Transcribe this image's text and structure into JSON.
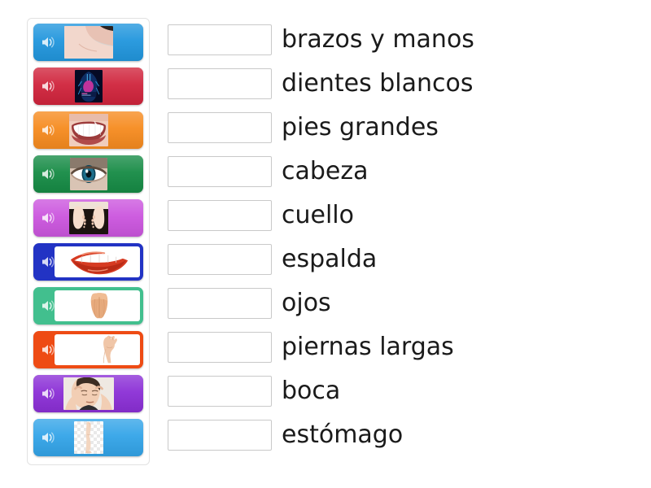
{
  "activity": {
    "type": "match-up-audio-to-text",
    "language": "es"
  },
  "tiles_panel": {
    "name": "audio-tiles-panel",
    "tiles": [
      {
        "index": 1,
        "color": "#2196dd",
        "style": "solid",
        "icon": "speaker-icon",
        "image": "neck-photo",
        "alt": "cuello"
      },
      {
        "index": 2,
        "color": "#d0243c",
        "style": "solid",
        "icon": "speaker-icon",
        "image": "stomach-diagram",
        "alt": "estomago"
      },
      {
        "index": 3,
        "color": "#f68b1f",
        "style": "solid",
        "icon": "speaker-icon",
        "image": "white-teeth-photo",
        "alt": "dientes blancos"
      },
      {
        "index": 4,
        "color": "#168b45",
        "style": "solid",
        "icon": "speaker-icon",
        "image": "eye-photo",
        "alt": "ojos"
      },
      {
        "index": 5,
        "color": "#cb55de",
        "style": "solid",
        "icon": "speaker-icon",
        "image": "baby-feet-photo",
        "alt": "pies grandes"
      },
      {
        "index": 6,
        "color": "#2233c4",
        "style": "framed",
        "icon": "speaker-icon",
        "image": "mouth-lips-clipart",
        "alt": "boca"
      },
      {
        "index": 7,
        "color": "#42bf8e",
        "style": "framed",
        "icon": "speaker-icon",
        "image": "back-torso-clipart",
        "alt": "espalda"
      },
      {
        "index": 8,
        "color": "#ee4b14",
        "style": "framed",
        "icon": "speaker-icon",
        "image": "raised-arm-photo",
        "alt": "brazos y manos"
      },
      {
        "index": 9,
        "color": "#8b2fd6",
        "style": "solid",
        "icon": "speaker-icon",
        "image": "man-head-photo",
        "alt": "cabeza"
      },
      {
        "index": 10,
        "color": "#33a4e8",
        "style": "solid",
        "icon": "speaker-icon",
        "image": "leg-cutout",
        "alt": "piernas largas"
      }
    ]
  },
  "answers": {
    "name": "answer-column",
    "drop_box_value": "",
    "items": [
      {
        "index": 1,
        "label": "brazos y manos"
      },
      {
        "index": 2,
        "label": "dientes blancos"
      },
      {
        "index": 3,
        "label": "pies grandes"
      },
      {
        "index": 4,
        "label": "cabeza"
      },
      {
        "index": 5,
        "label": "cuello"
      },
      {
        "index": 6,
        "label": "espalda"
      },
      {
        "index": 7,
        "label": "ojos"
      },
      {
        "index": 8,
        "label": "piernas largas"
      },
      {
        "index": 9,
        "label": "boca"
      },
      {
        "index": 10,
        "label": "estómago"
      }
    ]
  },
  "colors": {
    "page_background": "#ffffff",
    "panel_border": "#e2e2e2",
    "drop_box_border": "#c9c9c9",
    "text": "#1a1a1a"
  }
}
